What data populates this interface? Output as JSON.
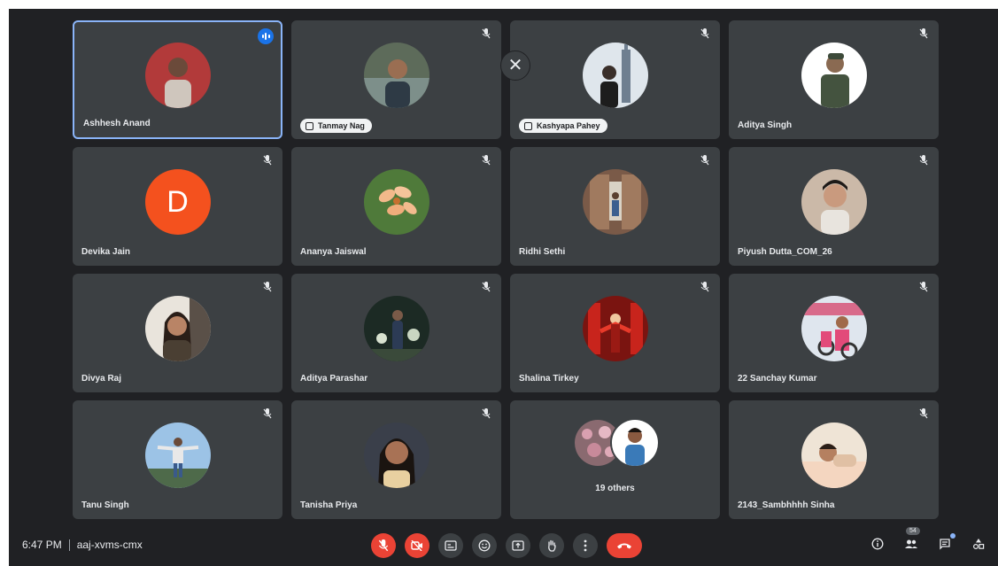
{
  "meeting": {
    "time": "6:47 PM",
    "code": "aaj-xvms-cmx",
    "participant_count": "54",
    "others_label": "19 others"
  },
  "colors": {
    "stage_bg": "#202124",
    "tile_bg": "#3c4043",
    "active_speaker_border": "#8ab4f8",
    "end_call": "#ea4335",
    "letter_avatar": "#f4511e"
  },
  "tiles": [
    {
      "name": "Ashhesh Anand",
      "speaking": true
    },
    {
      "name": "Tanmay Nag",
      "pinned_chip": true
    },
    {
      "name": "Kashyapa Pahey",
      "pinned_chip": true
    },
    {
      "name": "Aditya Singh"
    },
    {
      "name": "Devika Jain",
      "letter": "D"
    },
    {
      "name": "Ananya Jaiswal"
    },
    {
      "name": "Ridhi Sethi"
    },
    {
      "name": "Piyush Dutta_COM_26"
    },
    {
      "name": "Divya Raj"
    },
    {
      "name": "Aditya Parashar"
    },
    {
      "name": "Shalina Tirkey"
    },
    {
      "name": "22 Sanchay Kumar"
    },
    {
      "name": "Tanu Singh"
    },
    {
      "name": "Tanisha Priya"
    },
    {
      "name": ""
    },
    {
      "name": "2143_Sambhhhh Sinha"
    }
  ],
  "controls": [
    {
      "icon": "mic-off-icon"
    },
    {
      "icon": "camera-off-icon"
    },
    {
      "icon": "captions-icon"
    },
    {
      "icon": "emoji-icon"
    },
    {
      "icon": "present-icon"
    },
    {
      "icon": "raise-hand-icon"
    },
    {
      "icon": "more-options-icon"
    },
    {
      "icon": "end-call-icon"
    }
  ]
}
